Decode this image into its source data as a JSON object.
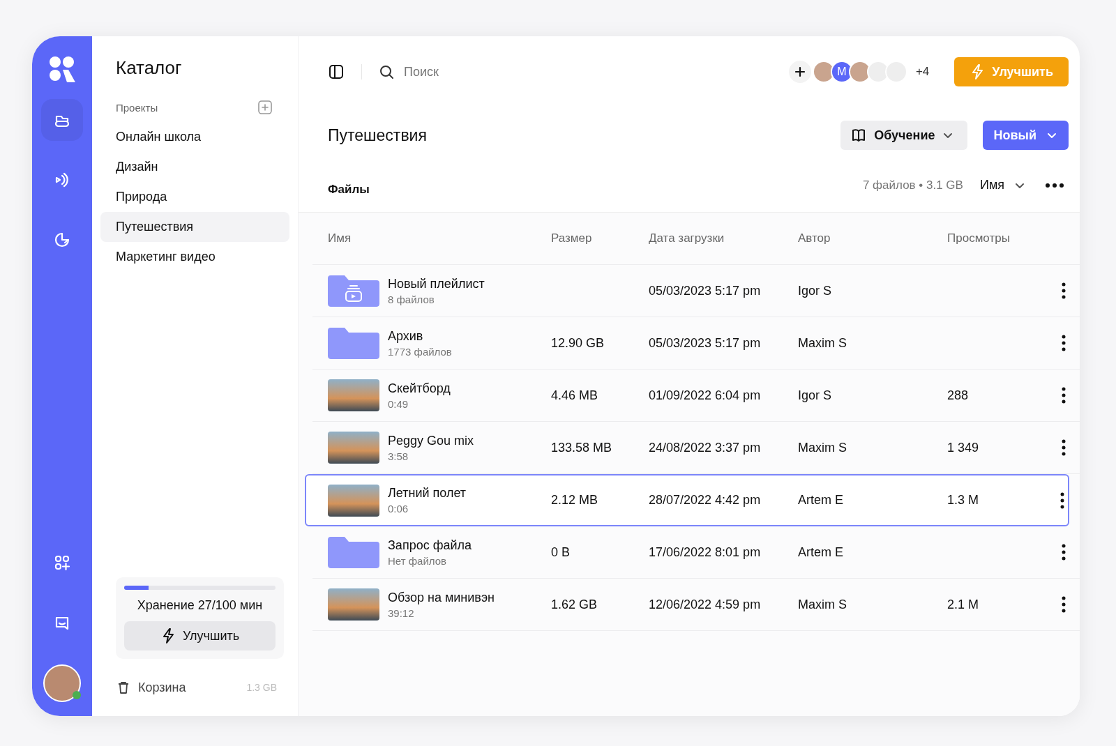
{
  "rail": {
    "items": [
      {
        "kind": "folder",
        "selected": true
      },
      {
        "kind": "broadcast",
        "selected": false
      },
      {
        "kind": "chart",
        "selected": false
      }
    ],
    "bottom_items": [
      {
        "kind": "apps"
      },
      {
        "kind": "chat"
      }
    ],
    "user": {
      "online": true
    }
  },
  "sidebar": {
    "title": "Каталог",
    "section": "Проекты",
    "projects": [
      {
        "label": "Онлайн школа",
        "selected": false
      },
      {
        "label": "Дизайн",
        "selected": false
      },
      {
        "label": "Природа",
        "selected": false
      },
      {
        "label": "Путешествия",
        "selected": true
      },
      {
        "label": "Маркетинг видео",
        "selected": false
      }
    ],
    "storage": {
      "label": "Хранение 27/100 мин",
      "level": 0.16,
      "button": "Улучшить"
    },
    "trash": {
      "label": "Корзина",
      "size": "1.3 GB"
    }
  },
  "topbar": {
    "search": {
      "placeholder": "Поиск"
    },
    "avatars": [
      {
        "kind": "photo"
      },
      {
        "kind": "letter",
        "text": "M"
      },
      {
        "kind": "photo"
      },
      {
        "kind": "blank"
      },
      {
        "kind": "blank"
      }
    ],
    "more": "+4",
    "upgrade": "Улучшить"
  },
  "page": {
    "title": "Путешествия",
    "guide_button": "Обучение",
    "new_button": "Новый",
    "section": "Файлы",
    "summary": "7 файлов • 3.1 GB",
    "sort": "Имя"
  },
  "table": {
    "columns": [
      "Имя",
      "Размер",
      "Дата загрузки",
      "Автор",
      "Просмотры"
    ],
    "rows": [
      {
        "kind": "playlist",
        "name": "Новый плейлист",
        "sub": "8 файлов",
        "size": "",
        "date": "05/03/2023 5:17 pm",
        "author": "Igor S",
        "views": "",
        "selected": false
      },
      {
        "kind": "folder",
        "name": "Архив",
        "sub": "1773 файлов",
        "size": "12.90 GB",
        "date": "05/03/2023 5:17 pm",
        "author": "Maxim S",
        "views": "",
        "selected": false
      },
      {
        "kind": "video",
        "name": "Скейтборд",
        "sub": "0:49",
        "size": "4.46 MB",
        "date": "01/09/2022 6:04 pm",
        "author": "Igor S",
        "views": "288",
        "selected": false
      },
      {
        "kind": "video",
        "name": "Peggy Gou mix",
        "sub": "3:58",
        "size": "133.58 MB",
        "date": "24/08/2022 3:37 pm",
        "author": "Maxim S",
        "views": "1 349",
        "selected": false
      },
      {
        "kind": "video",
        "name": "Летний полет",
        "sub": "0:06",
        "size": "2.12 MB",
        "date": "28/07/2022 4:42 pm",
        "author": "Artem E",
        "views": "1.3 M",
        "selected": true
      },
      {
        "kind": "folder",
        "name": "Запрос файла",
        "sub": "Нет файлов",
        "size": "0 B",
        "date": "17/06/2022 8:01 pm",
        "author": "Artem E",
        "views": "",
        "selected": false
      },
      {
        "kind": "video",
        "name": "Обзор на минивэн",
        "sub": "39:12",
        "size": "1.62 GB",
        "date": "12/06/2022 4:59 pm",
        "author": "Maxim S",
        "views": "2.1 M",
        "selected": false
      }
    ]
  }
}
